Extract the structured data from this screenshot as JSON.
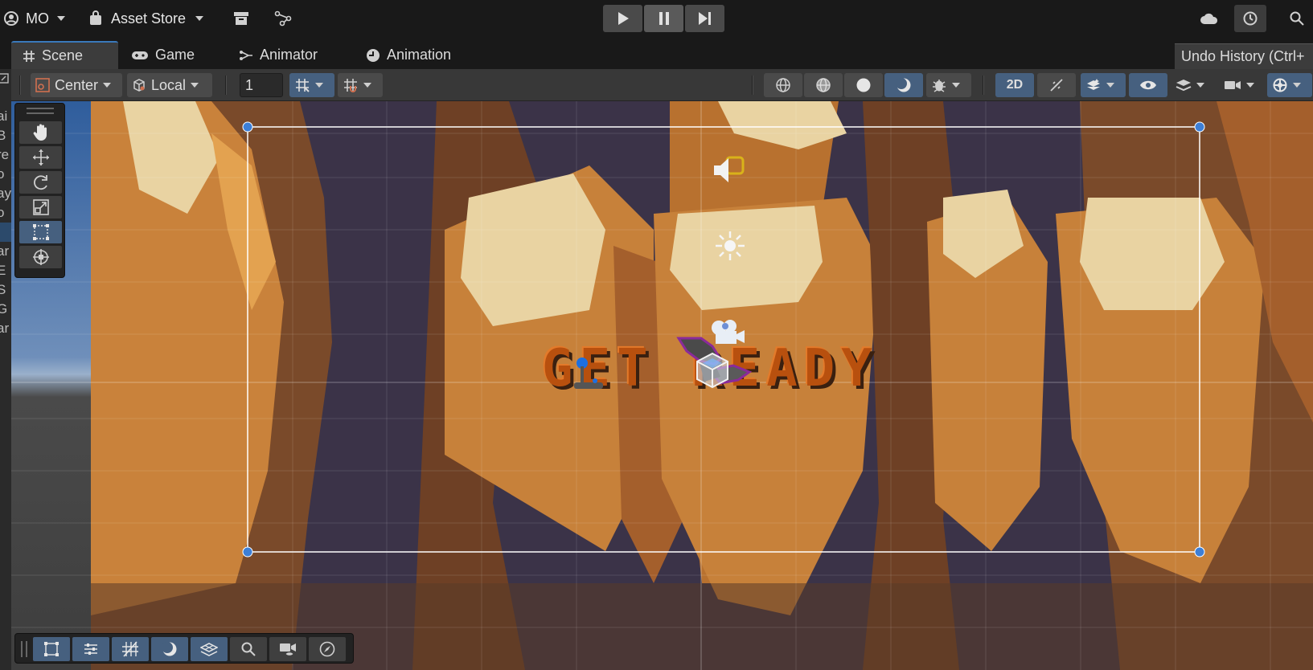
{
  "topbar": {
    "account_label": "MO",
    "asset_store_label": "Asset Store",
    "icons": [
      "account-icon",
      "store-bag-icon",
      "package-icon",
      "version-control-icon",
      "play-icon",
      "pause-icon",
      "step-icon",
      "cloud-icon",
      "history-icon",
      "search-icon"
    ]
  },
  "tabs": [
    {
      "label": "Scene",
      "icon": "grid-icon",
      "active": true
    },
    {
      "label": "Game",
      "icon": "gamepad-icon",
      "active": false
    },
    {
      "label": "Animator",
      "icon": "animator-icon",
      "active": false
    },
    {
      "label": "Animation",
      "icon": "clock-icon",
      "active": false
    }
  ],
  "undo_tab_label": "Undo History (Ctrl+",
  "scene_toolbar": {
    "pivot_mode": "Center",
    "pivot_rotation": "Local",
    "grid_size_value": "1",
    "toggle_2d_label": "2D"
  },
  "left_strip_letters": [
    "ai",
    "B",
    "re",
    "o",
    "ay",
    "o",
    "",
    "ar",
    "E",
    "S",
    "G",
    "ar"
  ],
  "scene_content": {
    "title_text": "GET READY"
  },
  "colors": {
    "accent_blue": "#46607f",
    "tab_highlight": "#3a79bb",
    "text_orange": "#b8500e"
  }
}
